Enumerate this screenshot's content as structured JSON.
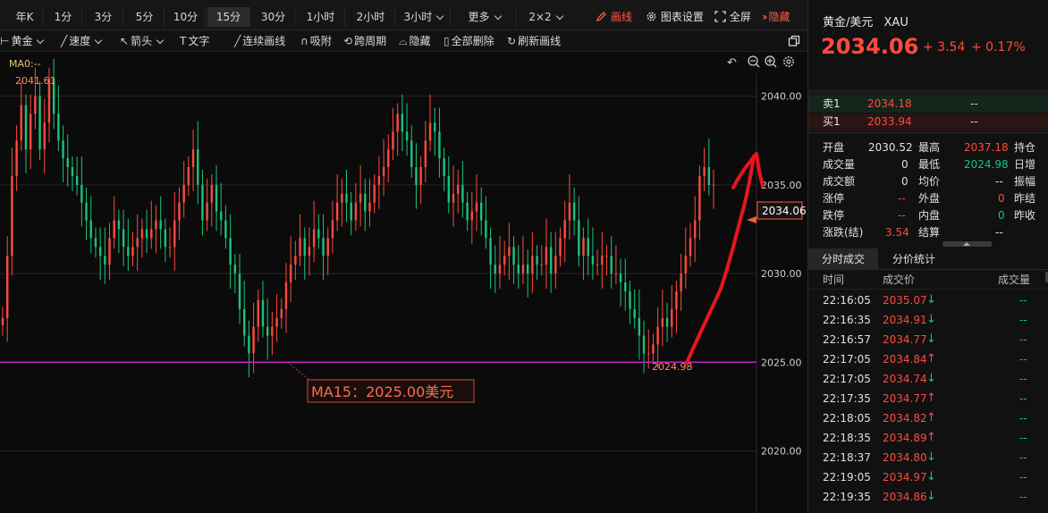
{
  "toolbar": {
    "timeframes": [
      "年K",
      "1分",
      "3分",
      "5分",
      "10分",
      "15分",
      "30分",
      "1小时",
      "2小时",
      "3小时",
      "更多",
      "2×2"
    ],
    "active_timeframe": "15分",
    "draw_label": "画线",
    "chart_settings_label": "图表设置",
    "fullscreen_label": "全屏",
    "hide_label": "隐藏"
  },
  "drawbar": {
    "items": [
      "黄金",
      "速度",
      "箭头",
      "文字",
      "连续画线",
      "吸附",
      "跨周期",
      "隐藏",
      "全部删除",
      "刷新画线"
    ]
  },
  "chart": {
    "ma_label": "MA0:--",
    "high_label": "2041.61",
    "low_label": "2024.98",
    "current_price_tag": "2034.06",
    "annotation": "MA15：2025.00美元",
    "y_ticks": [
      "2040.00",
      "2035.00",
      "2030.00",
      "2025.00",
      "2020.00"
    ]
  },
  "chart_data": {
    "type": "candlestick",
    "title": "",
    "ylim": [
      2016.5,
      2042.5
    ],
    "y_ticks": [
      2040.0,
      2035.0,
      2030.0,
      2025.0,
      2020.0
    ],
    "grid": true,
    "horizontal_lines": [
      {
        "label": "MA15：2025.00美元",
        "value": 2025.0,
        "color": "#cc22cc"
      }
    ],
    "marked_high": 2041.61,
    "marked_low": 2024.98,
    "last_price": 2034.06,
    "closes": [
      2027.5,
      2031,
      2035.5,
      2037.5,
      2039.5,
      2037,
      2039,
      2040,
      2037,
      2038.5,
      2041,
      2039,
      2037.5,
      2036.5,
      2036,
      2035.5,
      2035,
      2034,
      2033,
      2032,
      2031.5,
      2031,
      2030.5,
      2032,
      2033,
      2032.5,
      2031.5,
      2031,
      2031.5,
      2032,
      2032.5,
      2032,
      2032.5,
      2033,
      2032.5,
      2031.5,
      2031.5,
      2033,
      2034,
      2035,
      2036,
      2037,
      2035,
      2033,
      2034,
      2035,
      2033.5,
      2033,
      2032,
      2030.5,
      2030,
      2028,
      2026.5,
      2025.5,
      2027,
      2028.5,
      2027,
      2026.5,
      2027,
      2027.5,
      2028,
      2029.5,
      2030.5,
      2031,
      2032,
      2031,
      2031.5,
      2032.5,
      2032,
      2031,
      2032,
      2033,
      2034,
      2034.5,
      2034,
      2033,
      2034,
      2034.5,
      2033.5,
      2034,
      2035,
      2035.5,
      2036,
      2037,
      2038,
      2039,
      2038,
      2037.5,
      2036,
      2035,
      2036,
      2037.5,
      2038.5,
      2038,
      2036.5,
      2035.5,
      2034,
      2034.5,
      2035,
      2034,
      2033,
      2033.5,
      2034,
      2033,
      2032,
      2030.5,
      2030,
      2030.5,
      2031,
      2031.5,
      2030.5,
      2030,
      2030.5,
      2030,
      2031,
      2030.5,
      2030.5,
      2031.5,
      2030,
      2031,
      2032,
      2033,
      2034,
      2033,
      2031,
      2032,
      2031,
      2030.5,
      2030.5,
      2031,
      2031,
      2030,
      2030,
      2029.5,
      2029,
      2028,
      2027.5,
      2026.5,
      2025.5,
      2025.5,
      2026,
      2027,
      2027.5,
      2027,
      2028,
      2029,
      2030,
      2031,
      2032,
      2033,
      2035.5,
      2036,
      2035,
      2035
    ]
  },
  "quote": {
    "symbol": "黄金/美元",
    "code": "XAU",
    "price": "2034.06",
    "change": "+ 3.54",
    "change_pct": "+ 0.17%",
    "sell_label": "卖1",
    "sell_price": "2034.18",
    "sell_qty": "--",
    "buy_label": "买1",
    "buy_price": "2033.94",
    "buy_qty": "--",
    "stats": {
      "open_label": "开盘",
      "open": "2030.52",
      "high_label": "最高",
      "high": "2037.18",
      "hold_label": "持仓",
      "volume_label": "成交量",
      "volume": "0",
      "low_label": "最低",
      "low": "2024.98",
      "daily_inc_label": "日增",
      "amount_label": "成交额",
      "amount": "0",
      "avg_label": "均价",
      "avg": "--",
      "amplitude_label": "振幅",
      "limit_up_label": "涨停",
      "limit_up": "--",
      "outer_label": "外盘",
      "outer": "0",
      "prev_settle_label": "昨结",
      "limit_down_label": "跌停",
      "limit_down": "--",
      "inner_label": "内盘",
      "inner": "0",
      "prev_close_label": "昨收",
      "change_settle_label": "涨跌(结)",
      "change_settle": "3.54",
      "settle_label": "结算",
      "settle": "--"
    }
  },
  "trades": {
    "tabs": [
      "分时成交",
      "分价统计"
    ],
    "headers": [
      "时间",
      "成交价",
      "成交量"
    ],
    "rows": [
      {
        "time": "22:16:05",
        "price": "2035.07",
        "dir": "down",
        "vol": "--"
      },
      {
        "time": "22:16:35",
        "price": "2034.91",
        "dir": "down",
        "vol": "--"
      },
      {
        "time": "22:16:57",
        "price": "2034.77",
        "dir": "down",
        "vol": "--"
      },
      {
        "time": "22:17:05",
        "price": "2034.84",
        "dir": "up",
        "vol": "--"
      },
      {
        "time": "22:17:05",
        "price": "2034.74",
        "dir": "down",
        "vol": "--"
      },
      {
        "time": "22:17:35",
        "price": "2034.77",
        "dir": "up",
        "vol": "--"
      },
      {
        "time": "22:18:05",
        "price": "2034.82",
        "dir": "up",
        "vol": "--"
      },
      {
        "time": "22:18:35",
        "price": "2034.89",
        "dir": "up",
        "vol": "--"
      },
      {
        "time": "22:18:37",
        "price": "2034.80",
        "dir": "down",
        "vol": "--"
      },
      {
        "time": "22:19:05",
        "price": "2034.97",
        "dir": "down",
        "vol": "--"
      },
      {
        "time": "22:19:35",
        "price": "2034.86",
        "dir": "down",
        "vol": "--"
      }
    ]
  },
  "colors": {
    "up": "#ff4a3d",
    "down": "#19c37d",
    "ma_line": "#cc22cc",
    "annotation": "#ff6a50"
  }
}
